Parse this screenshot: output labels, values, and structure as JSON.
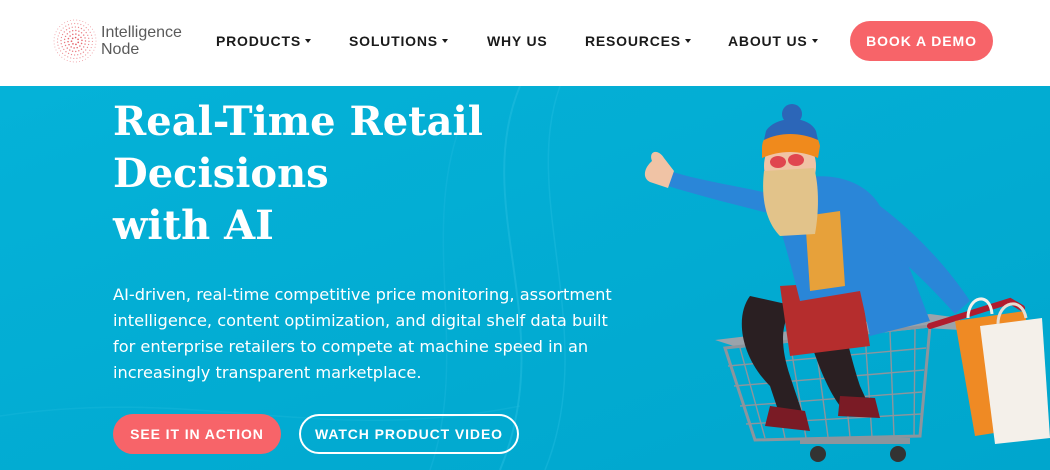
{
  "brand": {
    "name_line1": "Intelligence",
    "name_line2": "Node",
    "logo_icon": "dotted-globe-logo-icon"
  },
  "nav": {
    "items": [
      {
        "label": "PRODUCTS",
        "has_dropdown": true
      },
      {
        "label": "SOLUTIONS",
        "has_dropdown": true
      },
      {
        "label": "WHY US",
        "has_dropdown": false
      },
      {
        "label": "RESOURCES",
        "has_dropdown": true
      },
      {
        "label": "ABOUT US",
        "has_dropdown": true
      }
    ],
    "cta_label": "BOOK A DEMO"
  },
  "hero": {
    "headline_line1": "Real-Time Retail",
    "headline_line2": "Decisions",
    "headline_line3": "with AI",
    "subtext": "AI-driven, real-time competitive price monitoring, assortment intelligence, content optimization, and digital shelf data built for enterprise retailers to compete at machine speed in an increasingly transparent marketplace.",
    "primary_button": "SEE IT IN ACTION",
    "secondary_button": "WATCH PRODUCT VIDEO",
    "image_subject": "woman-riding-shopping-cart-illustration"
  },
  "colors": {
    "accent": "#f76469",
    "hero_background": "#00acd3",
    "header_background": "#ffffff",
    "nav_text": "#1a1a1a"
  }
}
